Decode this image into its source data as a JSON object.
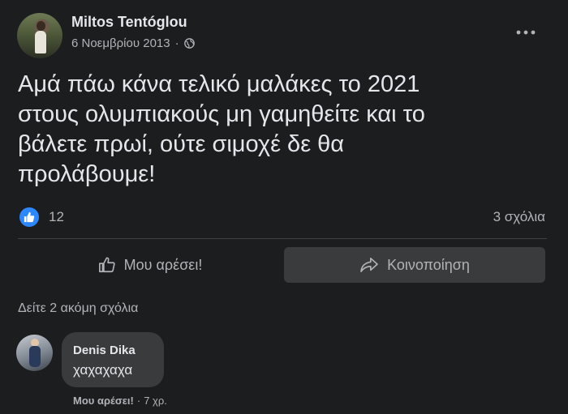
{
  "post": {
    "author": "Miltos Tentóglou",
    "date": "6 Νοεμβρίου 2013",
    "separator": "·",
    "privacy_icon": "globe-icon",
    "more_icon": "more-horizontal-icon",
    "text": "Αμά πάω κάνα τελικό μαλάκες το 2021\nστους ολυμπιακούς μη γαμηθείτε και το\nβάλετε πρωί, ούτε σιμοχέ δε θα\nπρολάβουμε!",
    "reactions": {
      "icon": "like-icon",
      "count": "12"
    },
    "comments_count": "3 σχόλια"
  },
  "actions": {
    "like_label": "Μου αρέσει!",
    "share_label": "Κοινοποίηση"
  },
  "comments": {
    "more_label": "Δείτε 2 ακόμη σχόλια",
    "items": [
      {
        "author": "Denis Dika",
        "text": "χαχαχαχα",
        "like_label": "Μου αρέσει!",
        "separator": "·",
        "time": "7 χρ."
      }
    ]
  },
  "colors": {
    "background": "#1c1d1f",
    "text": "#e4e6eb",
    "secondary_text": "#b0b3b8",
    "accent": "#2d88ff",
    "bubble": "#3a3b3c"
  }
}
